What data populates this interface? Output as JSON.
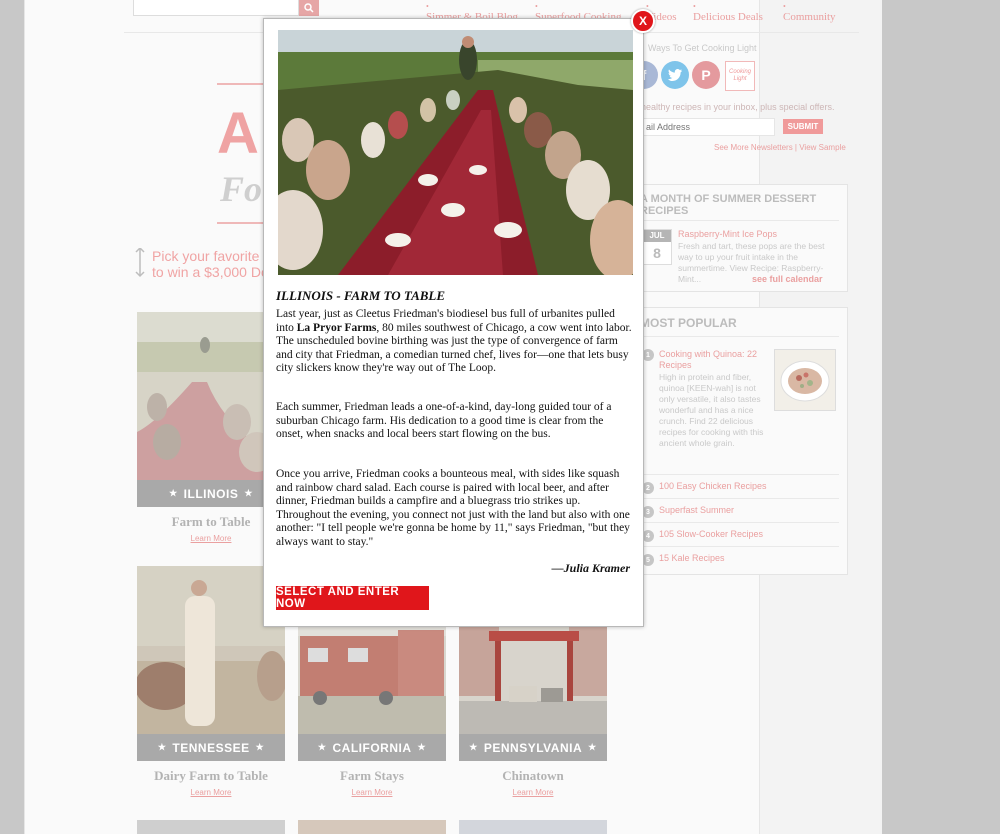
{
  "header": {
    "nav": [
      "Simmer & Boil Blog",
      "Superfood Cooking",
      "Videos",
      "Delicious Deals",
      "Community"
    ]
  },
  "hero": {
    "big_letters": "A",
    "script_text": "Fo",
    "pick_text_line1": "Pick your favorite",
    "pick_text_line2": "to win a $3,000 Do"
  },
  "cards": [
    {
      "state": "ILLINOIS",
      "title": "Farm to Table",
      "link": "Learn More"
    },
    {
      "state": "TENNESSEE",
      "title": "Dairy Farm to Table",
      "link": "Learn More"
    },
    {
      "state": "CALIFORNIA",
      "title": "Farm Stays",
      "link": "Learn More"
    },
    {
      "state": "PENNSYLVANIA",
      "title": "Chinatown",
      "link": "Learn More"
    }
  ],
  "sidebar": {
    "ways_title": "Ways To Get Cooking Light",
    "newsletter_text": "healthy recipes in your inbox, plus special offers.",
    "email_placeholder": "ail Address",
    "submit_label": "SUBMIT",
    "newsletter_links": "See More Newsletters | View Sample",
    "calendar_box": {
      "title_line1": "A MONTH OF SUMMER DESSERT",
      "title_line2": "RECIPES",
      "month": "JUL",
      "day": "8",
      "item_title": "Raspberry-Mint Ice Pops",
      "item_desc": "Fresh and tart, these pops are the best way to up your fruit intake in the summertime. View Recipe: Raspberry-Mint...",
      "calendar_link": "see full calendar"
    },
    "popular": {
      "title": "MOST POPULAR",
      "featured_title": "Cooking with Quinoa: 22 Recipes",
      "featured_desc": "High in protein and fiber, quinoa [KEEN-wah] is not only versatile, it also tastes wonderful and has a nice crunch. Find 22 delicious recipes for cooking with this ancient whole grain.",
      "items": [
        {
          "num": "1"
        },
        {
          "num": "2",
          "label": "100 Easy Chicken Recipes"
        },
        {
          "num": "3",
          "label": "Superfast Summer"
        },
        {
          "num": "4",
          "label": "105 Slow-Cooker Recipes"
        },
        {
          "num": "5",
          "label": "15 Kale Recipes"
        }
      ]
    }
  },
  "modal": {
    "close_label": "X",
    "title": "ILLINOIS - FARM TO TABLE",
    "para1_a": "Last year, just as Cleetus Friedman's biodiesel bus full of urbanites pulled into ",
    "para1_bold": "La Pryor Farms",
    "para1_b": ", 80 miles southwest of Chicago, a cow went into labor. The unscheduled bovine birthing was just the type of convergence of farm and city that Friedman, a comedian turned chef, lives for—one that lets busy city slickers know they're way out of The Loop.",
    "para2": "Each summer, Friedman leads a one-of-a-kind, day-long guided tour of a suburban Chicago farm. His dedication to a good time is clear from the onset, when snacks and local beers start flowing on the bus.",
    "para3": "Once you arrive, Friedman cooks a bounteous meal, with sides like squash and rainbow chard salad. Each course is paired with local beer, and after dinner, Friedman builds a campfire and a bluegrass trio strikes up. Throughout the evening, you connect not just with the land but also with one another: \"I tell people we're gonna be home by 11,\" says Friedman, \"but they always want to stay.\"",
    "author": "—Julia Kramer",
    "cta": "SELECT AND ENTER NOW"
  },
  "colors": {
    "accent_red": "#e0161b",
    "faded_pink": "#eaa0a0",
    "banner_gray": "#a9a9a9"
  }
}
